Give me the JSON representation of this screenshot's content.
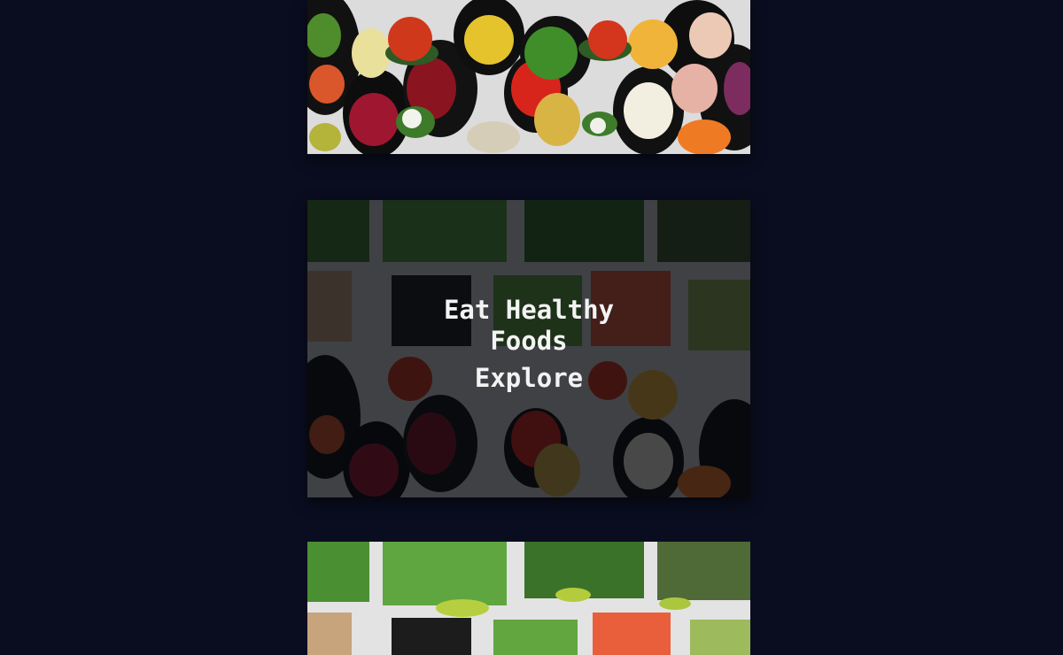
{
  "cards": [
    {
      "image": "vegetable-bowls-photo"
    },
    {
      "image": "vegetable-bowls-photo-dimmed",
      "title": "Eat Healthy Foods",
      "link_label": "Explore"
    },
    {
      "image": "salad-greens-photo"
    }
  ],
  "colors": {
    "page_background": "#0a0d1f",
    "overlay_text": "#f3f3f3"
  }
}
